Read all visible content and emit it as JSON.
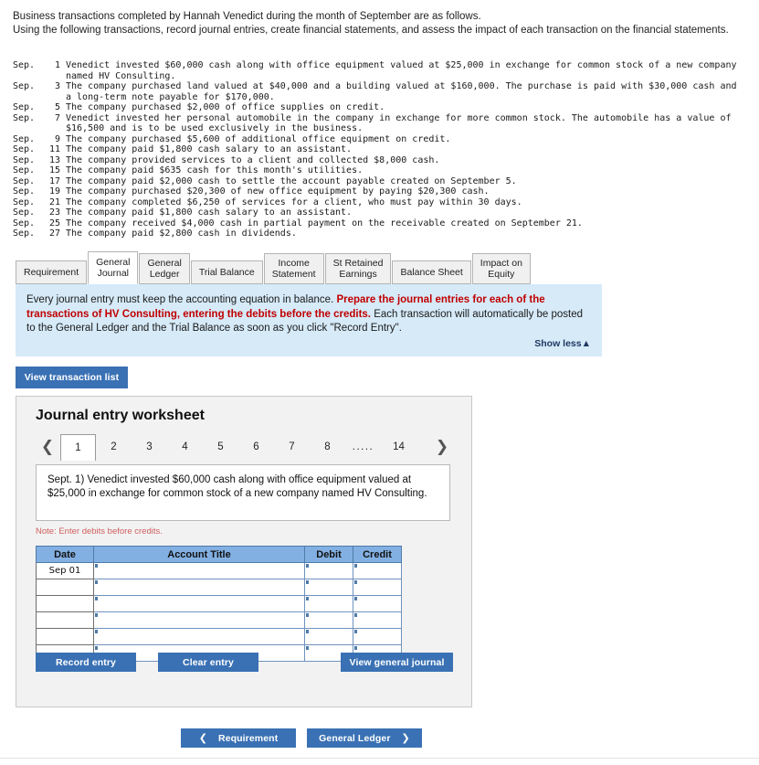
{
  "intro": {
    "line1": "Business transactions completed by Hannah Venedict during the month of September are as follows.",
    "line2": "Using the following transactions, record journal entries, create financial statements, and assess the impact of each transaction on the financial statements."
  },
  "transactions": [
    {
      "month": "Sep.",
      "day": "1",
      "text": "Venedict invested $60,000 cash along with office equipment valued at $25,000 in exchange for common stock of a new company",
      "cont": "named HV Consulting."
    },
    {
      "month": "Sep.",
      "day": "3",
      "text": "The company purchased land valued at $40,000 and a building valued at $160,000. The purchase is paid with $30,000 cash and",
      "cont": "a long-term note payable for $170,000."
    },
    {
      "month": "Sep.",
      "day": "5",
      "text": "The company purchased $2,000 of office supplies on credit.",
      "cont": ""
    },
    {
      "month": "Sep.",
      "day": "7",
      "text": "Venedict invested her personal automobile in the company in exchange for more common stock. The automobile has a value of",
      "cont": "$16,500 and is to be used exclusively in the business."
    },
    {
      "month": "Sep.",
      "day": "9",
      "text": "The company purchased $5,600 of additional office equipment on credit.",
      "cont": ""
    },
    {
      "month": "Sep.",
      "day": "11",
      "text": "The company paid $1,800 cash salary to an assistant.",
      "cont": ""
    },
    {
      "month": "Sep.",
      "day": "13",
      "text": "The company provided services to a client and collected $8,000 cash.",
      "cont": ""
    },
    {
      "month": "Sep.",
      "day": "15",
      "text": "The company paid $635 cash for this month's utilities.",
      "cont": ""
    },
    {
      "month": "Sep.",
      "day": "17",
      "text": "The company paid $2,000 cash to settle the account payable created on September 5.",
      "cont": ""
    },
    {
      "month": "Sep.",
      "day": "19",
      "text": "The company purchased $20,300 of new office equipment by paying $20,300 cash.",
      "cont": ""
    },
    {
      "month": "Sep.",
      "day": "21",
      "text": "The company completed $6,250 of services for a client, who must pay within 30 days.",
      "cont": ""
    },
    {
      "month": "Sep.",
      "day": "23",
      "text": "The company paid $1,800 cash salary to an assistant.",
      "cont": ""
    },
    {
      "month": "Sep.",
      "day": "25",
      "text": "The company received $4,000 cash in partial payment on the receivable created on September 21.",
      "cont": ""
    },
    {
      "month": "Sep.",
      "day": "27",
      "text": "The company paid $2,800 cash in dividends.",
      "cont": ""
    }
  ],
  "tabs": [
    {
      "label": "Requirement",
      "active": false
    },
    {
      "label": "General\nJournal",
      "active": true
    },
    {
      "label": "General\nLedger",
      "active": false
    },
    {
      "label": "Trial Balance",
      "active": false
    },
    {
      "label": "Income\nStatement",
      "active": false
    },
    {
      "label": "St Retained\nEarnings",
      "active": false
    },
    {
      "label": "Balance Sheet",
      "active": false
    },
    {
      "label": "Impact on\nEquity",
      "active": false
    }
  ],
  "callout": {
    "part1": "Every journal entry must keep the accounting equation in balance. ",
    "highlight": "Prepare the journal entries for each of the transactions of HV Consulting, entering the debits before the credits.",
    "part2": " Each transaction will automatically be posted to the General Ledger and the Trial Balance as soon as you click \"Record Entry\".",
    "show_less": "Show less▲"
  },
  "buttons": {
    "view_transaction_list": "View transaction list",
    "record_entry": "Record entry",
    "clear_entry": "Clear entry",
    "view_general_journal": "View general journal",
    "prev_nav": "Requirement",
    "next_nav": "General Ledger",
    "prev_chevron": "❮",
    "next_chevron": "❯"
  },
  "worksheet": {
    "title": "Journal entry worksheet",
    "pager": {
      "prev_icon": "❮",
      "next_icon": "❯",
      "pages": [
        "1",
        "2",
        "3",
        "4",
        "5",
        "6",
        "7",
        "8"
      ],
      "dots": ".....",
      "last": "14",
      "active_page": "1"
    },
    "description": "Sept. 1) Venedict invested $60,000 cash along with office equipment valued at $25,000 in exchange for common stock of a new company named HV Consulting.",
    "note": "Note: Enter debits before credits.",
    "table": {
      "headers": [
        "Date",
        "Account Title",
        "Debit",
        "Credit"
      ],
      "rows": [
        {
          "date": "Sep 01",
          "account": "",
          "debit": "",
          "credit": ""
        },
        {
          "date": "",
          "account": "",
          "debit": "",
          "credit": ""
        },
        {
          "date": "",
          "account": "",
          "debit": "",
          "credit": ""
        },
        {
          "date": "",
          "account": "",
          "debit": "",
          "credit": ""
        },
        {
          "date": "",
          "account": "",
          "debit": "",
          "credit": ""
        },
        {
          "date": "",
          "account": "",
          "debit": "",
          "credit": ""
        }
      ]
    }
  },
  "colors": {
    "accent_blue": "#3a71b4",
    "callout_bg": "#d6eaf8",
    "highlight_red": "#c00000",
    "table_header": "#83b0e2",
    "panel_bg": "#f2f2f2"
  }
}
